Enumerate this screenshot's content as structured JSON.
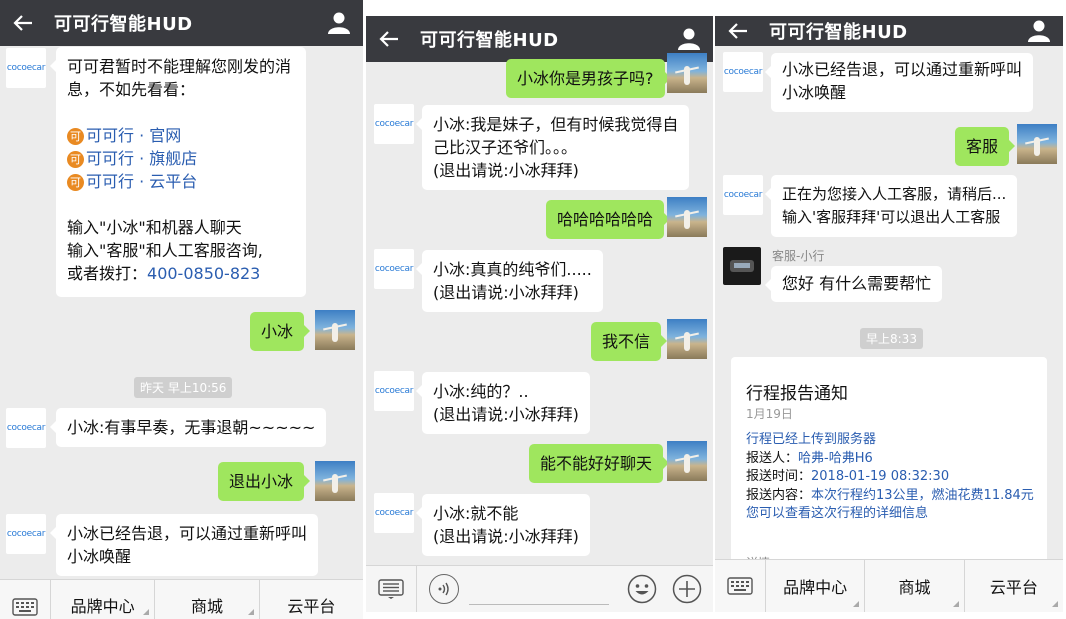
{
  "app_title": "可可行智能HUD",
  "logo_text": "cocoecar",
  "panel1": {
    "intro": {
      "line1": "可可君暂时不能理解您刚发的消",
      "line2": "息，不如先看看：",
      "links": [
        {
          "coin": "可",
          "text": "可可行 · 官网"
        },
        {
          "coin": "可",
          "text": "可可行 · 旗舰店"
        },
        {
          "coin": "可",
          "text": "可可行 · 云平台"
        }
      ],
      "tip1": "输入\"小冰\"和机器人聊天",
      "tip2": "输入\"客服\"和人工客服咨询,",
      "tip3_prefix": "或者拨打：",
      "phone": "400-0850-823"
    },
    "me1": "小冰",
    "timestamp": "昨天 早上10:56",
    "bot1": "小冰:有事早奏，无事退朝~~~~~",
    "me2": "退出小冰",
    "bot2_line1": "小冰已经告退，可以通过重新呼叫",
    "bot2_line2": "小冰唤醒",
    "menus": [
      "品牌中心",
      "商城",
      "云平台"
    ]
  },
  "panel2": {
    "me1": "小冰你是男孩子吗?",
    "bot1_line1": "小冰:我是妹子，但有时候我觉得自",
    "bot1_line2": "己比汉子还爷们。。。",
    "bot1_line3": "(退出请说:小冰拜拜)",
    "me2": "哈哈哈哈哈哈",
    "bot2_line1": "小冰:真真的纯爷们.....",
    "bot2_line2": "(退出请说:小冰拜拜)",
    "me3": "我不信",
    "bot3_line1": "小冰:纯的？..",
    "bot3_line2": "(退出请说:小冰拜拜)",
    "me4": "能不能好好聊天",
    "bot4_line1": "小冰:就不能",
    "bot4_line2": "(退出请说:小冰拜拜)"
  },
  "panel3": {
    "bot1_line1": "小冰已经告退，可以通过重新呼叫",
    "bot1_line2": "小冰唤醒",
    "me1": "客服",
    "bot2_line1": "正在为您接入人工客服，请稍后...",
    "bot2_line2": "输入'客服拜拜'可以退出人工客服",
    "agent_name": "客服-小行",
    "agent_msg": "您好  有什么需要帮忙",
    "timestamp": "早上8:33",
    "report": {
      "title": "行程报告通知",
      "date": "1月19日",
      "line1": "行程已经上传到服务器",
      "sender_label": "报送人：",
      "sender_value": "哈弗-哈弗H6",
      "time_label": "报送时间：",
      "time_value": "2018-01-19 08:32:30",
      "content_label": "报送内容：",
      "content_value": "本次行程约13公里，燃油花费11.84元",
      "line5": "您可以查看这次行程的详细信息",
      "more": "详情"
    },
    "menus": [
      "品牌中心",
      "商城",
      "云平台"
    ]
  },
  "colors": {
    "titlebar": "#393a3f",
    "chat_bg": "#ececec",
    "my_bubble": "#9fe65e",
    "link": "#2a5db0",
    "coin": "#e98a22"
  }
}
